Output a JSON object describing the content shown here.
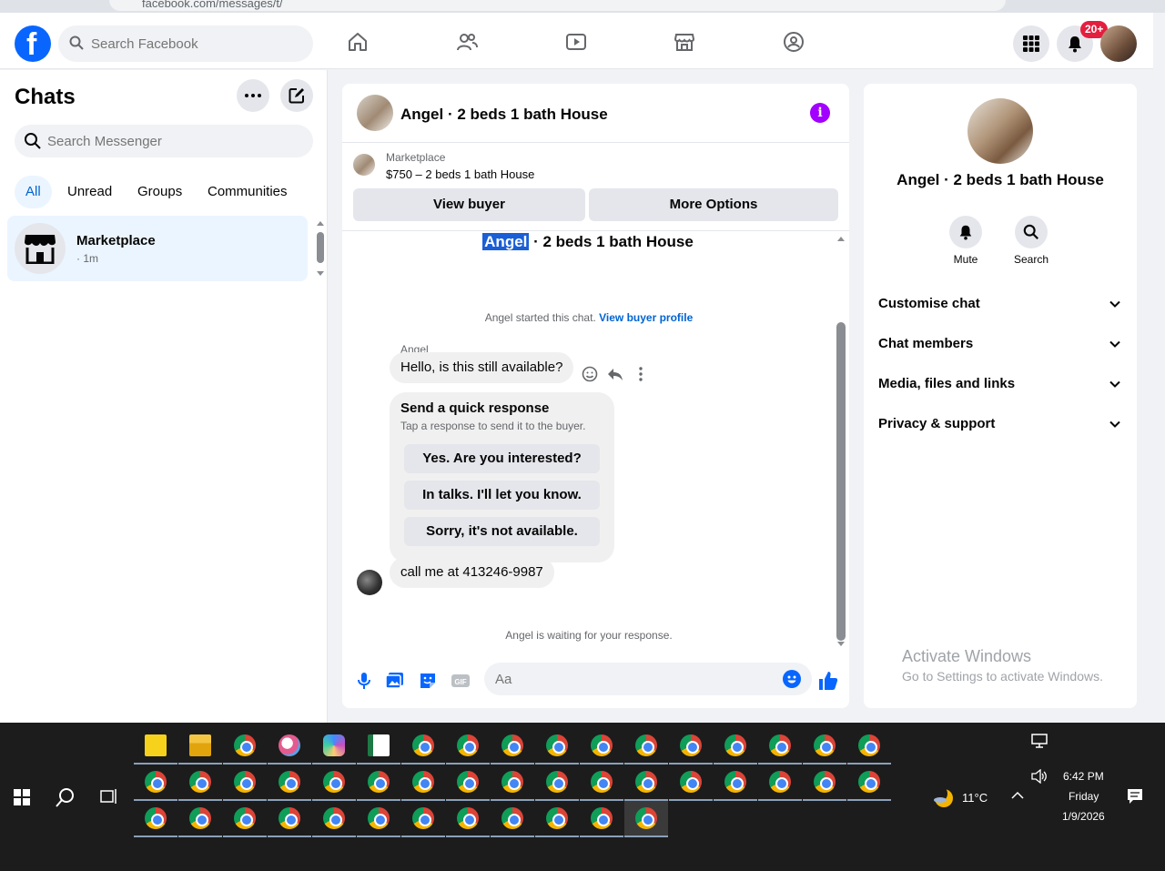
{
  "browser": {
    "url_fragment": "facebook.com/messages/t/"
  },
  "topbar": {
    "search_placeholder": "Search Facebook",
    "notifications_badge": "20+"
  },
  "left": {
    "title": "Chats",
    "search_placeholder": "Search Messenger",
    "filters": [
      "All",
      "Unread",
      "Groups",
      "Communities"
    ],
    "chat": {
      "name": "Marketplace",
      "time": "· 1m"
    }
  },
  "conversation": {
    "title": "Angel · 2 beds 1 bath House",
    "listing_source": "Marketplace",
    "listing_price": "$750 – 2 beds 1 bath House",
    "view_buyer": "View buyer",
    "more_options": "More Options",
    "thread_title_name": "Angel",
    "thread_title_rest": " · 2 beds 1 bath House",
    "started_text": "Angel started this chat.",
    "view_buyer_profile": "View buyer profile",
    "sender_name": "Angel",
    "message_1": "Hello, is this still available?",
    "quick_title": "Send a quick response",
    "quick_subtitle": "Tap a response to send it to the buyer.",
    "quick_replies": [
      "Yes. Are you interested?",
      "In talks. I'll let you know.",
      "Sorry, it's not available."
    ],
    "message_2": "call me at 413246-9987",
    "waiting": "Angel is waiting for your response.",
    "composer_placeholder": "Aa"
  },
  "right": {
    "name": "Angel · 2 beds 1 bath House",
    "mute": "Mute",
    "search": "Search",
    "rows": [
      "Customise chat",
      "Chat members",
      "Media, files and links",
      "Privacy & support"
    ]
  },
  "watermark": {
    "line1": "Activate Windows",
    "line2": "Go to Settings to activate Windows."
  },
  "taskbar": {
    "temperature": "11°C",
    "time": "6:42 PM",
    "day": "Friday",
    "date": "1/9/2026"
  },
  "colors": {
    "accent": "#0866ff",
    "link": "#0064d1",
    "info": "#a200ff",
    "badge": "#e41e3f"
  }
}
